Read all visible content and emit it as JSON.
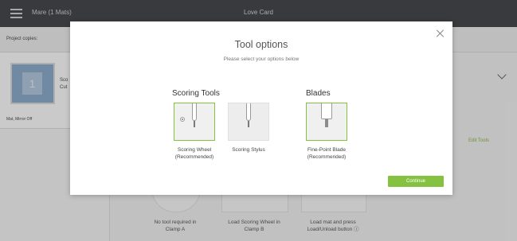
{
  "topbar": {
    "mats_label": "Mare (1 Mats)",
    "title": "Love Card"
  },
  "workspace": {
    "copies_label": "Project copies:",
    "mat_number": "1",
    "mat_side_line1": "Sco",
    "mat_side_line2": "Cut",
    "mat_mirror": "Mat, Mirror Off",
    "edit_tools": "Edit Tools",
    "steps": [
      {
        "line1": "No tool required in",
        "line2": "Clamp A"
      },
      {
        "line1": "Load Scoring Wheel in",
        "line2": "Clamp B"
      },
      {
        "line1": "Load mat and press",
        "line2": "Load/Unload button ⓘ"
      }
    ]
  },
  "modal": {
    "title": "Tool options",
    "subtitle": "Please select your options below",
    "scoring_heading": "Scoring Tools",
    "blades_heading": "Blades",
    "tools": [
      {
        "line1": "Scoring Wheel",
        "line2": "(Recommended)",
        "selected": true
      },
      {
        "line1": "Scoring Stylus",
        "line2": "",
        "selected": false
      },
      {
        "line1": "Fine-Point Blade",
        "line2": "(Recommended)",
        "selected": true
      }
    ],
    "continue_label": "Continue"
  },
  "colors": {
    "accent_green": "#86c242",
    "topbar_bg": "#2e3236"
  }
}
